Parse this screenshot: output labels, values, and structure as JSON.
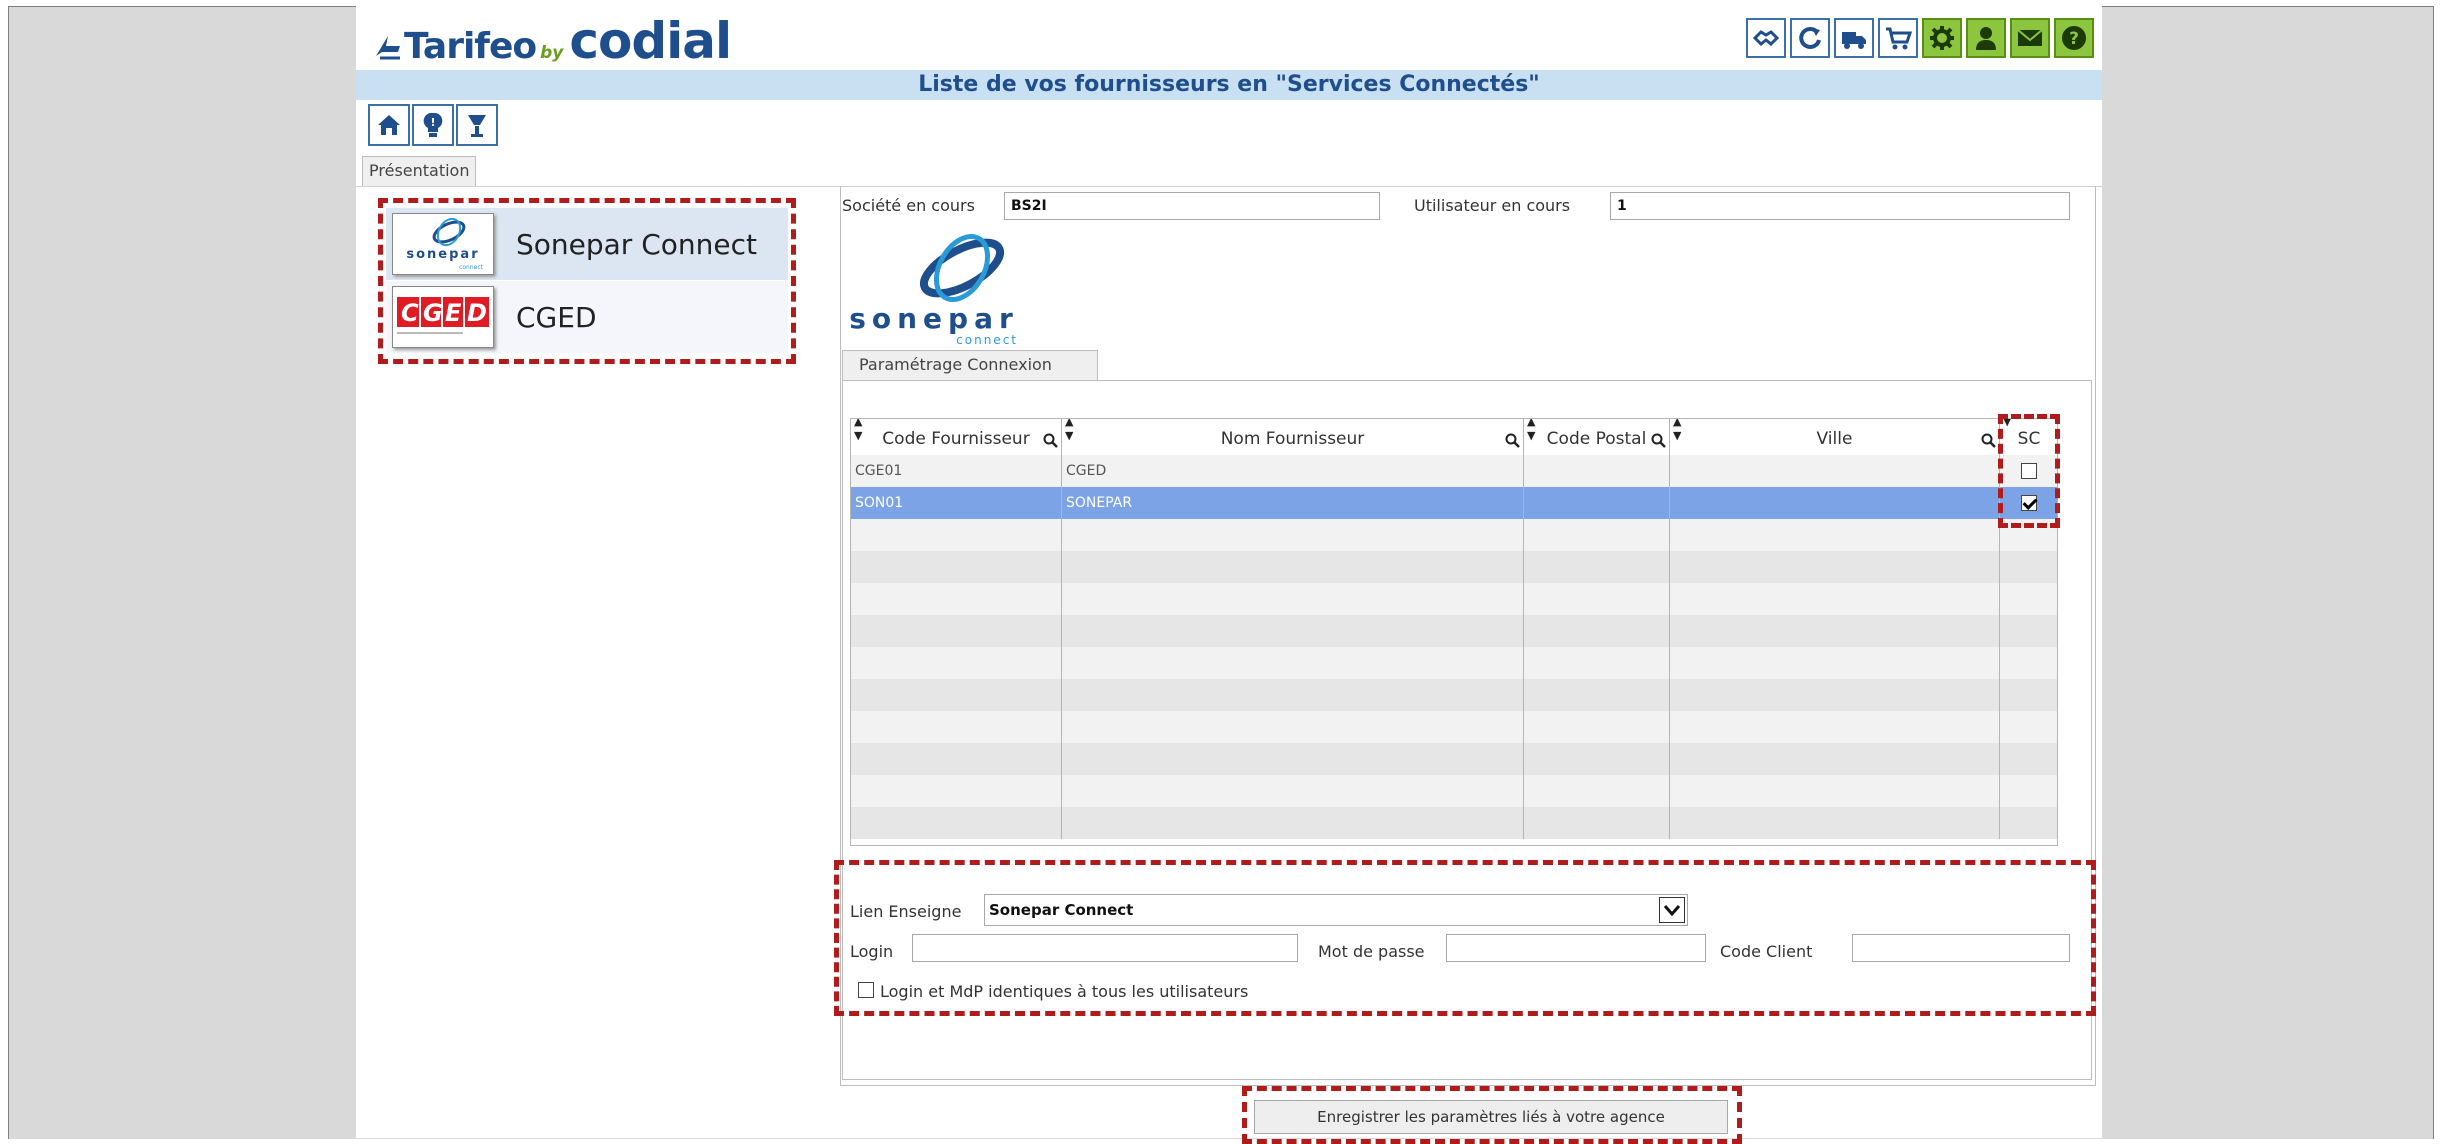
{
  "app": {
    "logo_main": "Tarifeo",
    "logo_by": "by",
    "logo_brand": "codial"
  },
  "header": {
    "title": "Liste de vos fournisseurs en \"Services Connectés\"",
    "icons": [
      "handshake-icon",
      "refresh-icon",
      "truck-icon",
      "cart-icon",
      "settings-icon",
      "user-icon",
      "mail-icon",
      "help-icon"
    ]
  },
  "nav": {
    "icons": [
      "home-icon",
      "lightbulb-icon",
      "lamp-icon"
    ]
  },
  "tabs": {
    "presentation": "Présentation",
    "parametrage": "Paramétrage Connexion"
  },
  "suppliers": [
    {
      "name": "Sonepar Connect",
      "logo_text": "sonepar"
    },
    {
      "name": "CGED",
      "logo_text": "CGED"
    }
  ],
  "context": {
    "societe_label": "Société en cours",
    "societe_value": "BS2I",
    "utilisateur_label": "Utilisateur en cours",
    "utilisateur_value": "1"
  },
  "sonepar_logo": {
    "word": "sonepar",
    "sub": "connect"
  },
  "grid": {
    "columns": [
      "Code Fournisseur",
      "Nom Fournisseur",
      "Code Postal",
      "Ville",
      "SC"
    ],
    "rows": [
      {
        "code": "CGE01",
        "nom": "CGED",
        "cp": "",
        "ville": "",
        "sc": false,
        "selected": false
      },
      {
        "code": "SON01",
        "nom": "SONEPAR",
        "cp": "",
        "ville": "",
        "sc": true,
        "selected": true
      }
    ]
  },
  "form": {
    "lien_label": "Lien Enseigne",
    "lien_value": "Sonepar Connect",
    "login_label": "Login",
    "login_value": "",
    "mdp_label": "Mot de passe",
    "mdp_value": "",
    "code_client_label": "Code Client",
    "code_client_value": "",
    "shared_label": "Login et MdP identiques à tous les utilisateurs",
    "shared_checked": false
  },
  "save_button": "Enregistrer les paramètres liés à votre agence",
  "colors": {
    "title_bg": "#c9dff2",
    "title_text": "#1f4e8c",
    "selection": "#7ba3e6",
    "highlight_dash": "#b01c1c",
    "icon_green": "#8cc63f"
  }
}
